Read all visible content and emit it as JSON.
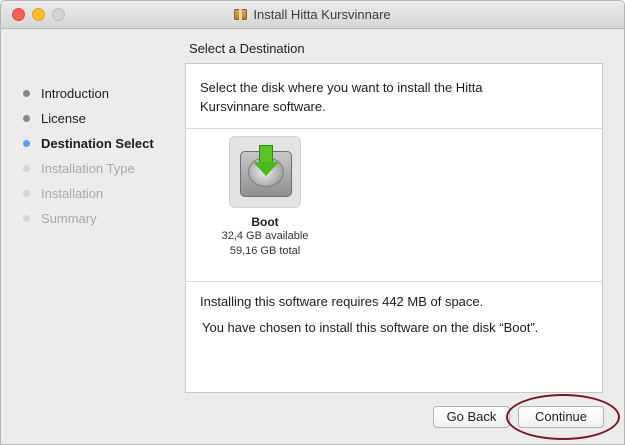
{
  "window": {
    "title": "Install Hitta Kursvinnare",
    "title_icon": "package-icon"
  },
  "heading": "Select a Destination",
  "sidebar": {
    "items": [
      {
        "label": "Introduction",
        "state": "done"
      },
      {
        "label": "License",
        "state": "done"
      },
      {
        "label": "Destination Select",
        "state": "current"
      },
      {
        "label": "Installation Type",
        "state": "pending"
      },
      {
        "label": "Installation",
        "state": "pending"
      },
      {
        "label": "Summary",
        "state": "pending"
      }
    ]
  },
  "main": {
    "intro_line1": "Select the disk where you want to install the Hitta",
    "intro_line2": "Kursvinnare software.",
    "disk": {
      "icon": "hard-disk-download-icon",
      "name": "Boot",
      "available": "32,4 GB available",
      "total": "59,16 GB total"
    },
    "requirement": "Installing this software requires 442 MB of space.",
    "chosen": "You have chosen to install this software on the disk “Boot”."
  },
  "buttons": {
    "back": "Go Back",
    "continue": "Continue"
  },
  "colors": {
    "current_step_dot": "#5d9bf7",
    "annotation_oval": "#7a1522",
    "close": "#fc5f57",
    "minimize": "#fdbc2e"
  }
}
